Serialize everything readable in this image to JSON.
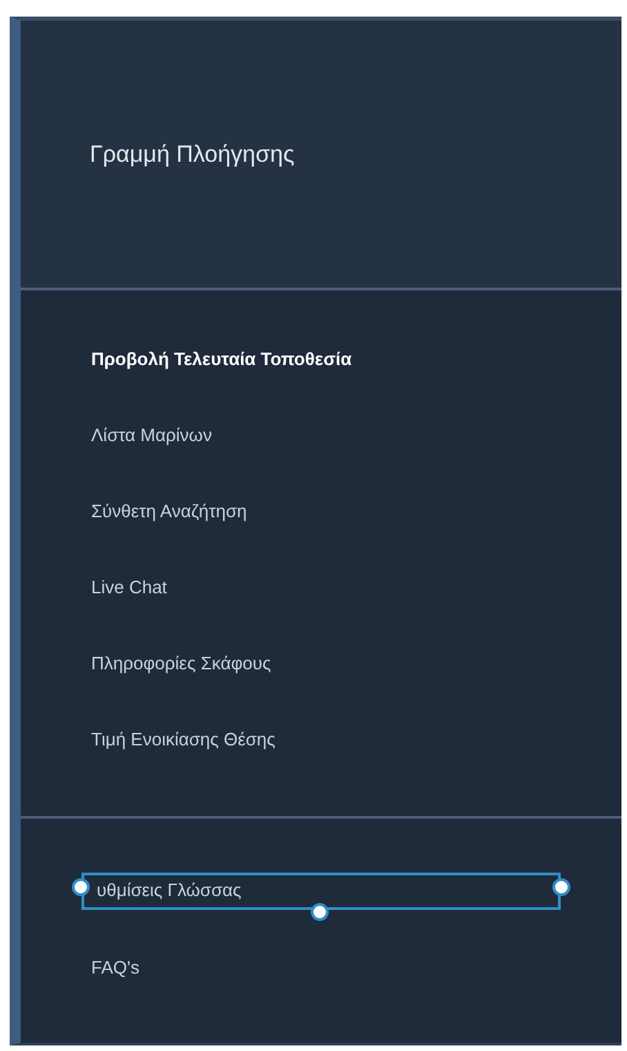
{
  "title": "Γραμμή Πλοήγησης",
  "menu_groups": [
    {
      "items": [
        {
          "label": "Προβολή Τελευταία Τοποθεσία",
          "active": true,
          "selected": false
        },
        {
          "label": "Λίστα Μαρίνων",
          "active": false,
          "selected": false
        },
        {
          "label": "Σύνθετη Αναζήτηση",
          "active": false,
          "selected": false
        },
        {
          "label": "Live Chat",
          "active": false,
          "selected": false
        },
        {
          "label": "Πληροφορίες Σκάφους",
          "active": false,
          "selected": false
        },
        {
          "label": "Τιμή Ενοικίασης Θέσης",
          "active": false,
          "selected": false
        }
      ]
    },
    {
      "items": [
        {
          "label": "υθμίσεις Γλώσσας",
          "active": false,
          "selected": true
        },
        {
          "label": "FAQ's",
          "active": false,
          "selected": false
        }
      ]
    }
  ]
}
